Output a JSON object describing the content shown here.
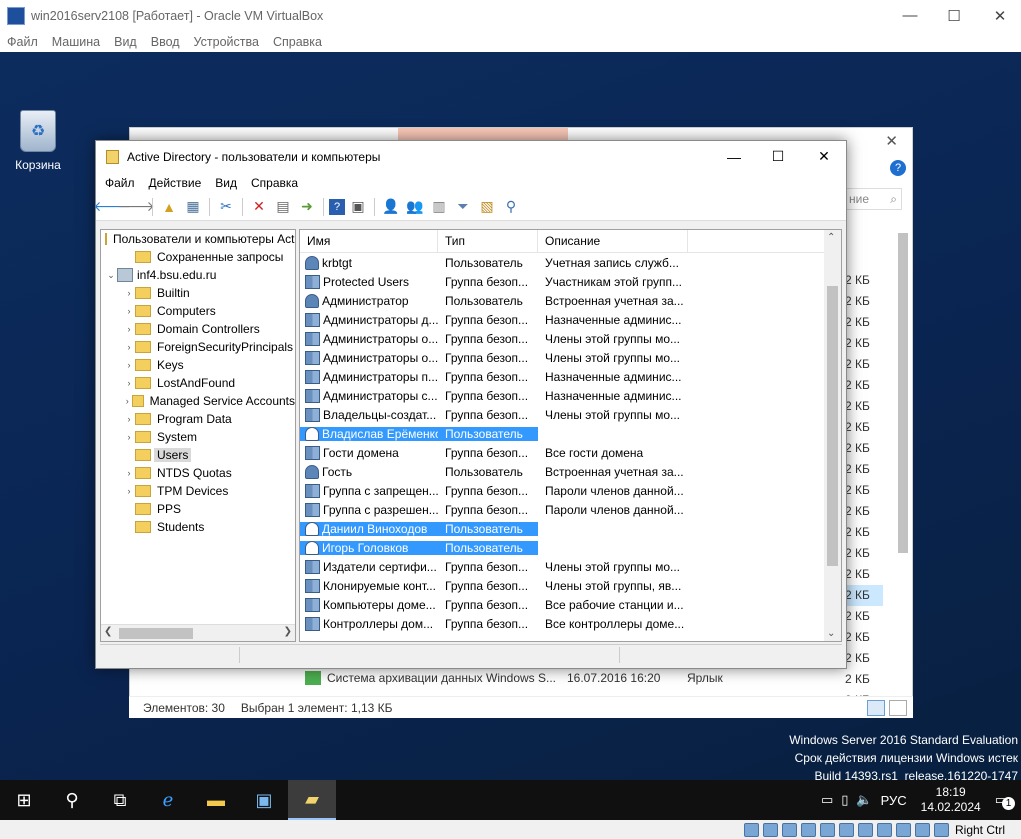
{
  "vbox": {
    "title": "win2016serv2108 [Работает] - Oracle VM VirtualBox",
    "menu": [
      "Файл",
      "Машина",
      "Вид",
      "Ввод",
      "Устройства",
      "Справка"
    ],
    "host_key": "Right Ctrl"
  },
  "desktop": {
    "recycle_label": "Корзина",
    "watermark": [
      "Windows Server 2016 Standard Evaluation",
      "Срок действия лицензии Windows истек",
      "Build 14393.rs1_release.161220-1747"
    ]
  },
  "bg_explorer": {
    "sizes": [
      "2 КБ",
      "2 КБ",
      "2 КБ",
      "2 КБ",
      "2 КБ",
      "2 КБ",
      "2 КБ",
      "2 КБ",
      "2 КБ",
      "2 КБ",
      "2 КБ",
      "2 КБ",
      "2 КБ",
      "2 КБ",
      "2 КБ",
      "2 КБ",
      "2 КБ",
      "2 КБ",
      "2 КБ",
      "2 КБ",
      "2 КБ"
    ],
    "selected_size_index": 15,
    "row_name": "Система архивации данных Windows S...",
    "row_date": "16.07.2016 16:20",
    "row_type": "Ярлык",
    "status_count": "Элементов: 30",
    "status_selected": "Выбран 1 элемент: 1,13 КБ",
    "search_hint": "ние"
  },
  "ad": {
    "title": "Active Directory - пользователи и компьютеры",
    "menu": [
      "Файл",
      "Действие",
      "Вид",
      "Справка"
    ],
    "tree": [
      {
        "label": "Пользователи и компьютеры Active Directory",
        "level": 0,
        "arrow": "",
        "icon": "root"
      },
      {
        "label": "Сохраненные запросы",
        "level": 1,
        "arrow": "",
        "icon": "folder"
      },
      {
        "label": "inf4.bsu.edu.ru",
        "level": 0,
        "arrow": "⌄",
        "icon": "domain"
      },
      {
        "label": "Builtin",
        "level": 1,
        "arrow": "›",
        "icon": "folder"
      },
      {
        "label": "Computers",
        "level": 1,
        "arrow": "›",
        "icon": "folder"
      },
      {
        "label": "Domain Controllers",
        "level": 1,
        "arrow": "›",
        "icon": "folder"
      },
      {
        "label": "ForeignSecurityPrincipals",
        "level": 1,
        "arrow": "›",
        "icon": "folder"
      },
      {
        "label": "Keys",
        "level": 1,
        "arrow": "›",
        "icon": "folder"
      },
      {
        "label": "LostAndFound",
        "level": 1,
        "arrow": "›",
        "icon": "folder"
      },
      {
        "label": "Managed Service Accounts",
        "level": 1,
        "arrow": "›",
        "icon": "folder"
      },
      {
        "label": "Program Data",
        "level": 1,
        "arrow": "›",
        "icon": "folder"
      },
      {
        "label": "System",
        "level": 1,
        "arrow": "›",
        "icon": "folder"
      },
      {
        "label": "Users",
        "level": 1,
        "arrow": "",
        "icon": "folder",
        "selected": true
      },
      {
        "label": "NTDS Quotas",
        "level": 1,
        "arrow": "›",
        "icon": "folder"
      },
      {
        "label": "TPM Devices",
        "level": 1,
        "arrow": "›",
        "icon": "folder"
      },
      {
        "label": "PPS",
        "level": 1,
        "arrow": "",
        "icon": "folder"
      },
      {
        "label": "Students",
        "level": 1,
        "arrow": "",
        "icon": "folder"
      }
    ],
    "columns": [
      "Имя",
      "Тип",
      "Описание"
    ],
    "rows": [
      {
        "name": "krbtgt",
        "type": "Пользователь",
        "desc": "Учетная запись служб...",
        "icon": "user"
      },
      {
        "name": "Protected Users",
        "type": "Группа безоп...",
        "desc": "Участникам этой групп...",
        "icon": "group"
      },
      {
        "name": "Администратор",
        "type": "Пользователь",
        "desc": "Встроенная учетная за...",
        "icon": "user"
      },
      {
        "name": "Администраторы д...",
        "type": "Группа безоп...",
        "desc": "Назначенные админис...",
        "icon": "group"
      },
      {
        "name": "Администраторы о...",
        "type": "Группа безоп...",
        "desc": "Члены этой группы мо...",
        "icon": "group"
      },
      {
        "name": "Администраторы о...",
        "type": "Группа безоп...",
        "desc": "Члены этой группы мо...",
        "icon": "group"
      },
      {
        "name": "Администраторы п...",
        "type": "Группа безоп...",
        "desc": "Назначенные админис...",
        "icon": "group"
      },
      {
        "name": "Администраторы с...",
        "type": "Группа безоп...",
        "desc": "Назначенные админис...",
        "icon": "group"
      },
      {
        "name": "Владельцы-создат...",
        "type": "Группа безоп...",
        "desc": "Члены этой группы мо...",
        "icon": "group"
      },
      {
        "name": "Владислав Ерёменко",
        "type": "Пользователь",
        "desc": "",
        "icon": "user",
        "selected": true
      },
      {
        "name": "Гости домена",
        "type": "Группа безоп...",
        "desc": "Все гости домена",
        "icon": "group"
      },
      {
        "name": "Гость",
        "type": "Пользователь",
        "desc": "Встроенная учетная за...",
        "icon": "user"
      },
      {
        "name": "Группа с запрещен...",
        "type": "Группа безоп...",
        "desc": "Пароли членов данной...",
        "icon": "group"
      },
      {
        "name": "Группа с разрешен...",
        "type": "Группа безоп...",
        "desc": "Пароли членов данной...",
        "icon": "group"
      },
      {
        "name": "Даниил Виноходов",
        "type": "Пользователь",
        "desc": "",
        "icon": "user",
        "selected": true
      },
      {
        "name": "Игорь Головков",
        "type": "Пользователь",
        "desc": "",
        "icon": "user",
        "selected": true
      },
      {
        "name": "Издатели сертифи...",
        "type": "Группа безоп...",
        "desc": "Члены этой группы мо...",
        "icon": "group"
      },
      {
        "name": "Клонируемые конт...",
        "type": "Группа безоп...",
        "desc": "Члены этой группы, яв...",
        "icon": "group"
      },
      {
        "name": "Компьютеры доме...",
        "type": "Группа безоп...",
        "desc": "Все рабочие станции и...",
        "icon": "group"
      },
      {
        "name": "Контроллеры дом...",
        "type": "Группа безоп...",
        "desc": "Все контроллеры доме...",
        "icon": "group"
      }
    ]
  },
  "taskbar": {
    "lang": "РУС",
    "time": "18:19",
    "date": "14.02.2024",
    "notif_count": "1"
  }
}
